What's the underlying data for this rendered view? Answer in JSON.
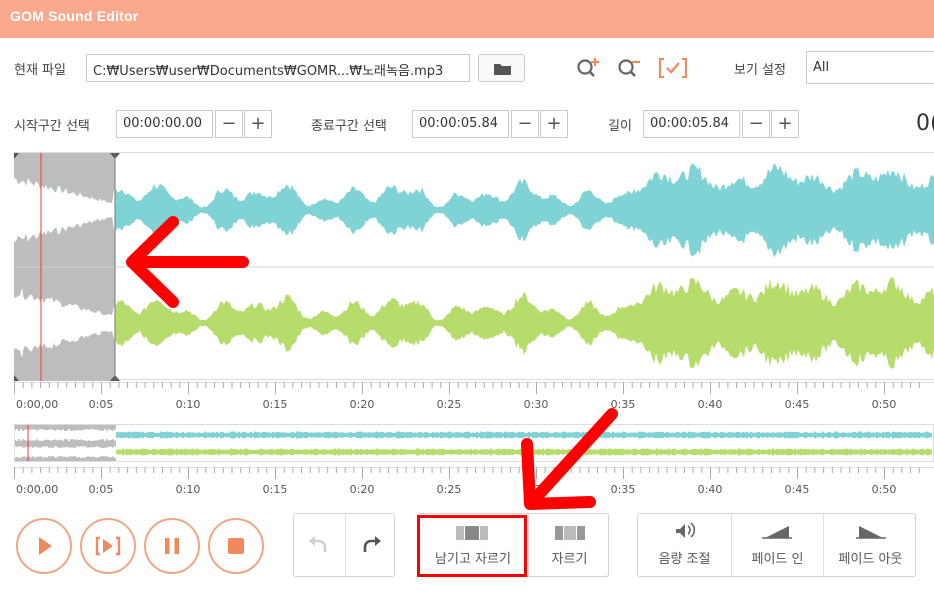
{
  "app": {
    "title": "GOM Sound Editor"
  },
  "toolbar": {
    "file_label": "현재 파일",
    "file_path": "C:₩Users₩user₩Documents₩GOMR...₩노래녹음.mp3",
    "view_label": "보기 설정",
    "view_value": "All"
  },
  "selection": {
    "start_label": "시작구간 선택",
    "start_value": "00:00:00.00",
    "end_label": "종료구간 선택",
    "end_value": "00:00:05.84",
    "length_label": "길이",
    "length_value": "00:00:05.84",
    "minus": "−",
    "plus": "+",
    "partial_time": "0("
  },
  "timeline": {
    "ticks": [
      "0:00,00",
      "0:05",
      "0:10",
      "0:15",
      "0:20",
      "0:25",
      "0:30",
      "0:35",
      "0:40",
      "0:45",
      "0:50"
    ]
  },
  "controls": {
    "keep_trim_label": "남기고 자르기",
    "trim_label": "자르기",
    "volume_label": "음량 조절",
    "fade_in_label": "페이드 인",
    "fade_out_label": "페이드 아웃"
  },
  "colors": {
    "titlebar": "#f9a98e",
    "accent": "#f08a5d",
    "wave_top": "#7fd3d4",
    "wave_bottom": "#b6dc6b",
    "selection": "#bdbdbd",
    "annotation": "#ff0000"
  }
}
